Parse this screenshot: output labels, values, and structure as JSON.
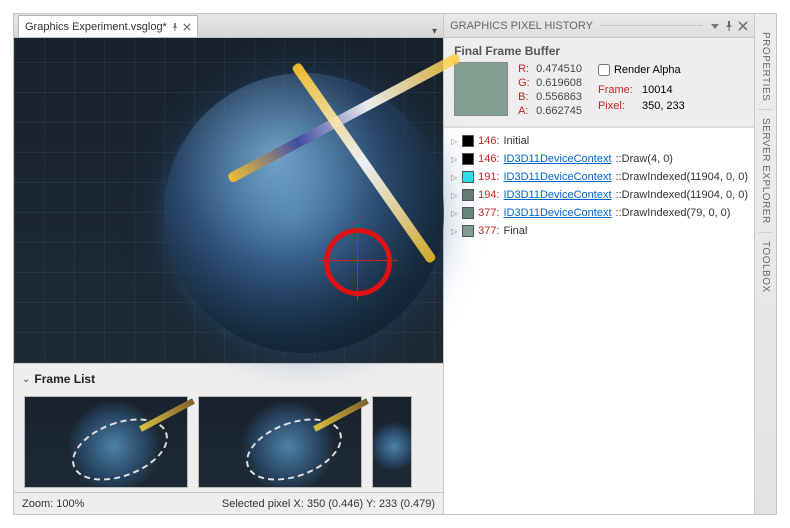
{
  "tab": {
    "title": "Graphics Experiment.vsglog*"
  },
  "frameList": {
    "title": "Frame List"
  },
  "status": {
    "zoom": "Zoom: 100%",
    "pixel": "Selected pixel X: 350 (0.446) Y: 233 (0.479)"
  },
  "historyPanel": {
    "title": "GRAPHICS PIXEL HISTORY",
    "frameBufferLabel": "Final Frame Buffer",
    "swatchColor": "#84a090",
    "rgba": {
      "rLabel": "R:",
      "r": "0.474510",
      "gLabel": "G:",
      "g": "0.619608",
      "bLabel": "B:",
      "b": "0.556863",
      "aLabel": "A:",
      "a": "0.662745"
    },
    "renderAlphaLabel": "Render Alpha",
    "frameLabel": "Frame:",
    "frameValue": "10014",
    "pixelLabel": "Pixel:",
    "pixelValue": "350, 233"
  },
  "events": [
    {
      "color": "#000000",
      "id": "146",
      "link": "",
      "label": "Initial"
    },
    {
      "color": "#000000",
      "id": "146",
      "link": "ID3D11DeviceContext",
      "method": "::Draw(4, 0)"
    },
    {
      "color": "#2de0ef",
      "id": "191",
      "link": "ID3D11DeviceContext",
      "method": "::DrawIndexed(11904, 0, 0)"
    },
    {
      "color": "#6a7c73",
      "id": "194",
      "link": "ID3D11DeviceContext",
      "method": "::DrawIndexed(11904, 0, 0)"
    },
    {
      "color": "#6a887a",
      "id": "377",
      "link": "ID3D11DeviceContext",
      "method": "::DrawIndexed(79, 0, 0)"
    },
    {
      "color": "#84a090",
      "id": "377",
      "link": "",
      "label": "Final"
    }
  ],
  "sideTabs": {
    "properties": "PROPERTIES",
    "serverExplorer": "SERVER EXPLORER",
    "toolbox": "TOOLBOX"
  }
}
